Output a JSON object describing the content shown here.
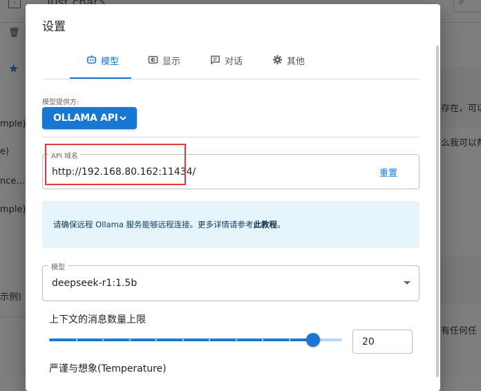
{
  "background": {
    "chat_title": "Just chat",
    "left_items": [
      "mple)",
      "e)",
      "nce...",
      "mple)",
      "示例)"
    ],
    "right_items": [
      "存在，可以",
      "么我可以帮",
      "有任何任"
    ]
  },
  "dialog": {
    "title": "设置",
    "tabs": [
      {
        "label": "模型",
        "icon": "robot-icon",
        "active": true
      },
      {
        "label": "显示",
        "icon": "display-icon",
        "active": false
      },
      {
        "label": "对话",
        "icon": "chat-icon",
        "active": false
      },
      {
        "label": "其他",
        "icon": "gear-icon",
        "active": false
      }
    ],
    "provider": {
      "label": "模型提供方:",
      "value": "OLLAMA API"
    },
    "api_host": {
      "legend": "API 域名",
      "value": "http://192.168.80.162:11434/",
      "reset_label": "重置"
    },
    "info": {
      "text": "请确保远程 Ollama 服务能够远程连接。更多详情请参考",
      "link": "此教程",
      "suffix": "。"
    },
    "model": {
      "legend": "模型",
      "value": "deepseek-r1:1.5b"
    },
    "context": {
      "label": "上下文的消息数量上限",
      "value": "20",
      "slider_fraction": 0.9
    },
    "temperature": {
      "label": "严谨与想象(Temperature)"
    }
  },
  "colors": {
    "accent": "#1976d2",
    "highlight_border": "#e53935",
    "info_bg": "#e6f4fc"
  }
}
